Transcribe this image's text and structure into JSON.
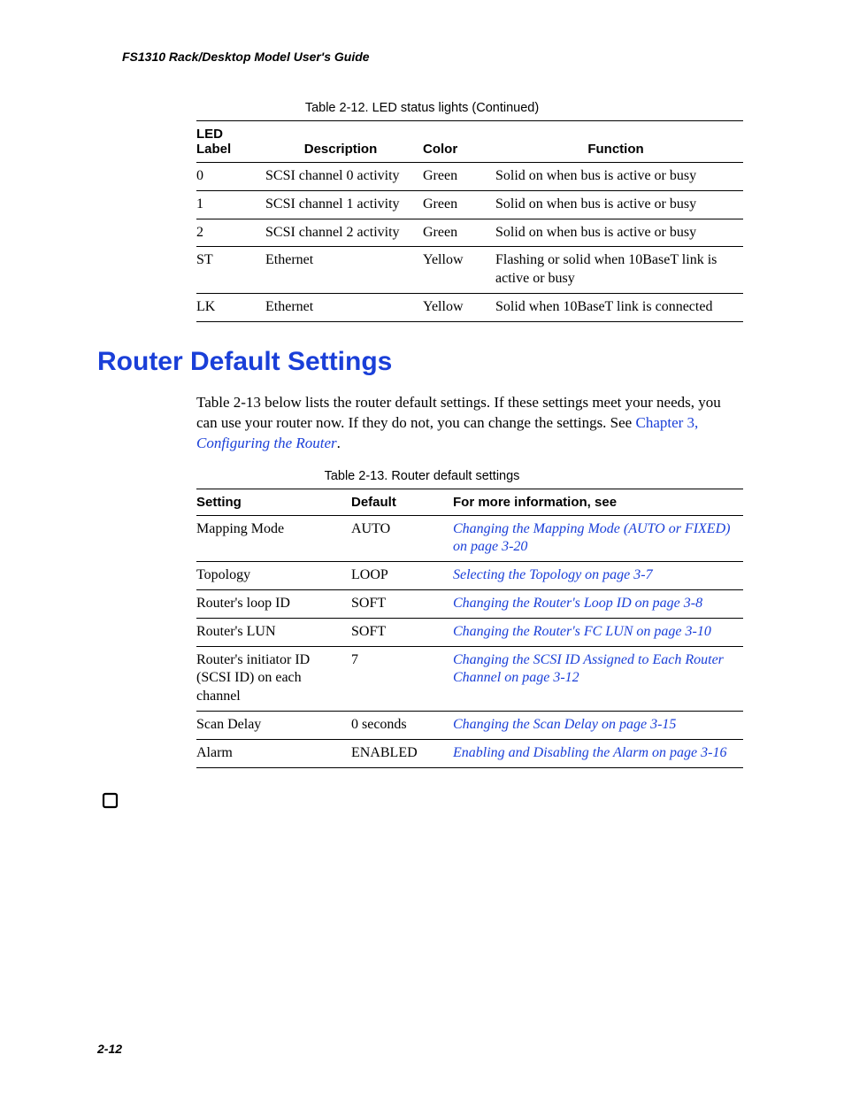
{
  "running_head": "FS1310 Rack/Desktop Model User's Guide",
  "table12": {
    "caption": "Table 2-12. LED status lights (Continued)",
    "headers": {
      "c0": "LED Label",
      "c1": "Description",
      "c2": "Color",
      "c3": "Function"
    },
    "rows": [
      {
        "c0": "0",
        "c1": "SCSI channel 0 activity",
        "c2": "Green",
        "c3": "Solid on when bus is active or busy"
      },
      {
        "c0": "1",
        "c1": "SCSI channel 1 activity",
        "c2": "Green",
        "c3": "Solid on when bus is active or busy"
      },
      {
        "c0": "2",
        "c1": "SCSI channel 2 activity",
        "c2": "Green",
        "c3": "Solid on when bus is active or busy"
      },
      {
        "c0": "ST",
        "c1": "Ethernet",
        "c2": "Yellow",
        "c3": "Flashing or solid when 10BaseT link is active or busy"
      },
      {
        "c0": "LK",
        "c1": "Ethernet",
        "c2": "Yellow",
        "c3": "Solid when 10BaseT link is connected"
      }
    ]
  },
  "section_heading": "Router Default Settings",
  "intro": {
    "text_before_link": "Table 2-13 below lists the router default settings. If these settings meet your needs, you can use your router now. If they do not, you can change the settings. See ",
    "link1": "Chapter 3, ",
    "link2": "Configuring the Router",
    "text_after": "."
  },
  "table13": {
    "caption": "Table 2-13. Router default settings",
    "headers": {
      "c0": "Setting",
      "c1": "Default",
      "c2": "For more information, see"
    },
    "rows": [
      {
        "c0": "Mapping Mode",
        "c1": "AUTO",
        "c2": "Changing the Mapping Mode (AUTO or FIXED) on page 3-20"
      },
      {
        "c0": "Topology",
        "c1": "LOOP",
        "c2": "Selecting the Topology on page 3-7"
      },
      {
        "c0": "Router's loop ID",
        "c1": "SOFT",
        "c2": "Changing the Router's Loop ID on page 3-8"
      },
      {
        "c0": "Router's LUN",
        "c1": "SOFT",
        "c2": "Changing the Router's FC LUN on page 3-10"
      },
      {
        "c0": "Router's initiator ID (SCSI ID) on each channel",
        "c1": "7",
        "c2": "Changing the SCSI ID Assigned to Each Router Channel on page 3-12"
      },
      {
        "c0": "Scan Delay",
        "c1": "0 seconds",
        "c2": "Changing the Scan Delay on page 3-15"
      },
      {
        "c0": "Alarm",
        "c1": "ENABLED",
        "c2": "Enabling and Disabling the Alarm on page 3-16"
      }
    ]
  },
  "page_number": "2-12"
}
